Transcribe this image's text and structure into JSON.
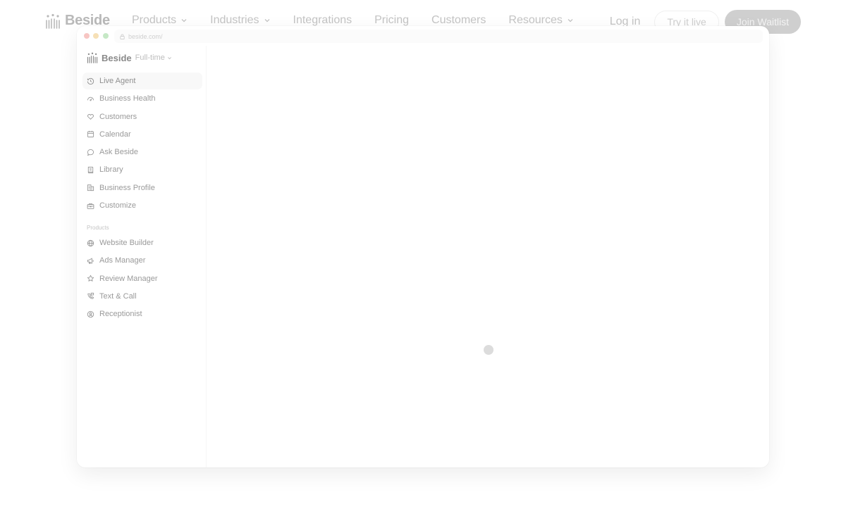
{
  "site_nav": {
    "logo_text": "Beside",
    "links": [
      {
        "label": "Products",
        "has_dropdown": true
      },
      {
        "label": "Industries",
        "has_dropdown": true
      },
      {
        "label": "Integrations",
        "has_dropdown": false
      },
      {
        "label": "Pricing",
        "has_dropdown": false
      },
      {
        "label": "Customers",
        "has_dropdown": false
      },
      {
        "label": "Resources",
        "has_dropdown": true
      }
    ],
    "login_label": "Log in",
    "try_label": "Try it live",
    "waitlist_label": "Join Waitlist"
  },
  "browser": {
    "url": "beside.com/"
  },
  "sidebar": {
    "workspace_name": "Beside",
    "plan_label": "Full-time",
    "items": [
      {
        "label": "Live Agent",
        "icon": "history-icon",
        "active": true
      },
      {
        "label": "Business Health",
        "icon": "gauge-icon",
        "active": false
      },
      {
        "label": "Customers",
        "icon": "heart-icon",
        "active": false
      },
      {
        "label": "Calendar",
        "icon": "calendar-icon",
        "active": false
      },
      {
        "label": "Ask Beside",
        "icon": "chat-bubble-icon",
        "active": false
      },
      {
        "label": "Library",
        "icon": "book-icon",
        "active": false
      },
      {
        "label": "Business Profile",
        "icon": "building-icon",
        "active": false
      },
      {
        "label": "Customize",
        "icon": "toolbox-icon",
        "active": false
      }
    ],
    "products_label": "Products",
    "products": [
      {
        "label": "Website Builder",
        "icon": "globe-icon"
      },
      {
        "label": "Ads Manager",
        "icon": "megaphone-icon"
      },
      {
        "label": "Review Manager",
        "icon": "star-icon"
      },
      {
        "label": "Text & Call",
        "icon": "phone-chat-icon"
      },
      {
        "label": "Receptionist",
        "icon": "receptionist-icon"
      }
    ]
  },
  "colors": {
    "primary_button": "#cfcfcf",
    "active_item_bg": "#f8f8f8",
    "loading_indicator": "#dcdcdc"
  }
}
